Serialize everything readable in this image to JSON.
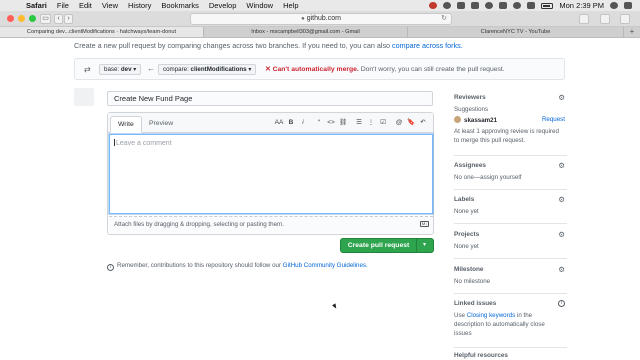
{
  "menubar": {
    "apple": "",
    "items": [
      "Safari",
      "File",
      "Edit",
      "View",
      "History",
      "Bookmarks",
      "Develop",
      "Window",
      "Help"
    ],
    "clock": "Mon 2:39 PM"
  },
  "toolbar": {
    "url": "github.com",
    "back": "‹",
    "forward": "›",
    "sidebar_toggle": "▭",
    "reload": "↻"
  },
  "tabs": [
    {
      "label": "Comparing dev...clientModifications · hatchways/team-donut",
      "active": true
    },
    {
      "label": "Inbox - mscampbell303@gmail.com - Gmail",
      "active": false
    },
    {
      "label": "ClarenceNYC TV - YouTube",
      "active": false
    }
  ],
  "intro": {
    "text": "Create a new pull request by comparing changes across two branches. If you need to, you can also ",
    "link": "compare across forks."
  },
  "compare": {
    "base_label": "base:",
    "base_value": "dev",
    "compare_label": "compare:",
    "compare_value": "clientModifications",
    "merge_icon": "✕",
    "merge_status": "Can't automatically merge.",
    "merge_note": "Don't worry, you can still create the pull request."
  },
  "form": {
    "title_value": "Create New Fund Page",
    "tab_write": "Write",
    "tab_preview": "Preview",
    "tools": [
      "AA",
      "B",
      "i",
      "“",
      "<>",
      "⛓",
      "☰",
      "⋮",
      "☑",
      "@",
      "🔖",
      "↶"
    ],
    "comment_placeholder": "Leave a comment",
    "attach_text": "Attach files by dragging & dropping, selecting or pasting them.",
    "md_icon": "M↓",
    "create_label": "Create pull request",
    "create_caret": "▾"
  },
  "guidelines": {
    "icon": "i",
    "text": "Remember, contributions to this repository should follow our ",
    "link": "GitHub Community Guidelines."
  },
  "sidebar": {
    "reviewers": {
      "heading": "Reviewers",
      "suggestions": "Suggestions",
      "reviewer": "skassam21",
      "request": "Request",
      "note": "At least 1 approving review is required to merge this pull request."
    },
    "assignees": {
      "heading": "Assignees",
      "text": "No one—assign yourself"
    },
    "labels": {
      "heading": "Labels",
      "text": "None yet"
    },
    "projects": {
      "heading": "Projects",
      "text": "None yet"
    },
    "milestone": {
      "heading": "Milestone",
      "text": "No milestone"
    },
    "linked_issues": {
      "heading": "Linked issues",
      "pre": "Use ",
      "link": "Closing keywords",
      "post": " in the description to automatically close issues"
    },
    "helpful": {
      "heading": "Helpful resources"
    },
    "gear": "⚙",
    "info": "i"
  },
  "colors": {
    "accent_link": "#0366d6",
    "success": "#2ea44f",
    "danger": "#cb2431"
  }
}
